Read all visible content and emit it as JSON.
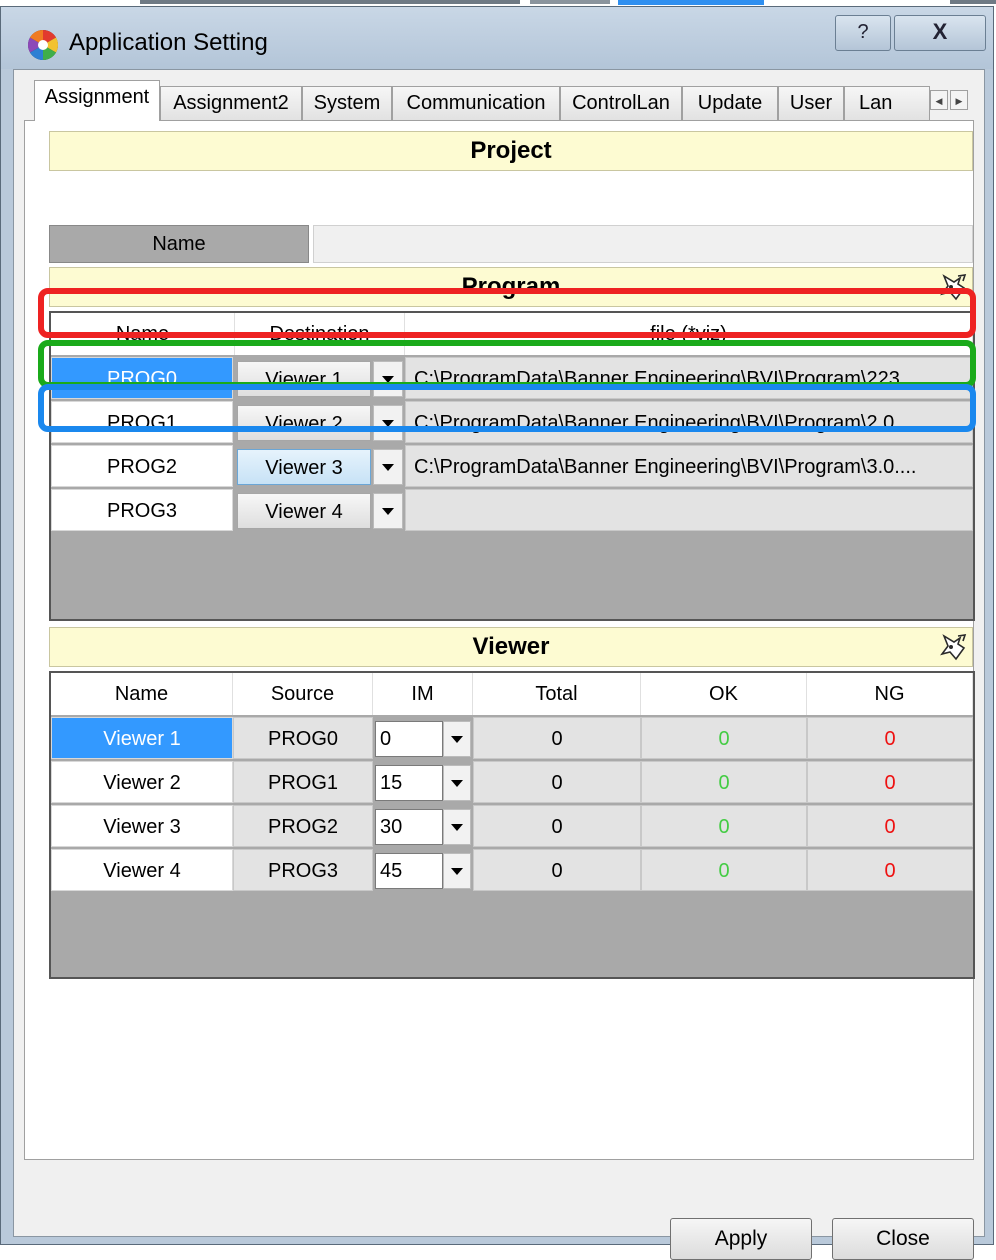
{
  "window": {
    "title": "Application Setting",
    "help_glyph": "?",
    "close_glyph": "X"
  },
  "tabs": [
    {
      "label": "Assignment",
      "active": true
    },
    {
      "label": "Assignment2"
    },
    {
      "label": "System"
    },
    {
      "label": "Communication"
    },
    {
      "label": "ControlLan"
    },
    {
      "label": "Update"
    },
    {
      "label": "User"
    },
    {
      "label": "Lan"
    }
  ],
  "project": {
    "header": "Project",
    "name_label": "Name",
    "name_value": ""
  },
  "program": {
    "header": "Program",
    "columns": [
      "Name",
      "Destination",
      "file (*viz)"
    ],
    "rows": [
      {
        "name": "PROG0",
        "destination": "Viewer 1",
        "file": "C:\\ProgramData\\Banner Engineering\\BVI\\Program\\223...."
      },
      {
        "name": "PROG1",
        "destination": "Viewer 2",
        "file": "C:\\ProgramData\\Banner Engineering\\BVI\\Program\\2.0...."
      },
      {
        "name": "PROG2",
        "destination": "Viewer 3",
        "file": "C:\\ProgramData\\Banner Engineering\\BVI\\Program\\3.0...."
      },
      {
        "name": "PROG3",
        "destination": "Viewer 4",
        "file": ""
      }
    ]
  },
  "viewer": {
    "header": "Viewer",
    "columns": [
      "Name",
      "Source",
      "IM",
      "Total",
      "OK",
      "NG"
    ],
    "rows": [
      {
        "name": "Viewer 1",
        "source": "PROG0",
        "im": "0",
        "total": "0",
        "ok": "0",
        "ng": "0"
      },
      {
        "name": "Viewer 2",
        "source": "PROG1",
        "im": "15",
        "total": "0",
        "ok": "0",
        "ng": "0"
      },
      {
        "name": "Viewer 3",
        "source": "PROG2",
        "im": "30",
        "total": "0",
        "ok": "0",
        "ng": "0"
      },
      {
        "name": "Viewer 4",
        "source": "PROG3",
        "im": "45",
        "total": "0",
        "ok": "0",
        "ng": "0"
      }
    ]
  },
  "buttons": {
    "apply": "Apply",
    "close": "Close"
  },
  "colors": {
    "selection": "#3399ff",
    "ok": "#44cc44",
    "ng": "#ee1111",
    "highlight_red": "#ee2222",
    "highlight_green": "#1aaa1a",
    "highlight_blue": "#1a88ee"
  }
}
